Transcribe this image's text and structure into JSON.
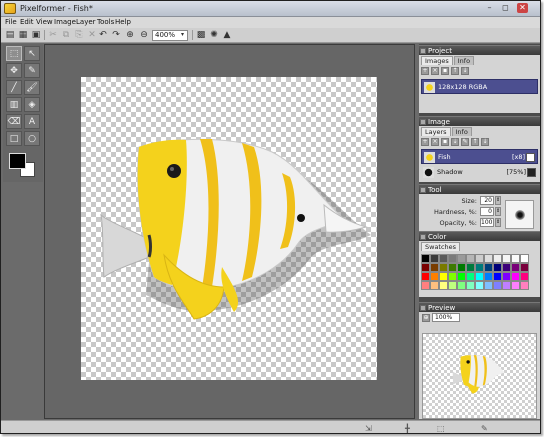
{
  "window": {
    "title": "Pixelformer - Fish*",
    "minimize": "–",
    "restore": "◻",
    "close": "✕"
  },
  "menu": [
    "File",
    "Edit",
    "View",
    "Image",
    "Layer",
    "Tools",
    "Help"
  ],
  "toolbar": {
    "zoom": "400%",
    "zoom_dropdown": "▾"
  },
  "panels": {
    "project": {
      "title": "Project",
      "tabs": [
        "Images",
        "Info"
      ],
      "items": [
        {
          "label": "128x128 RGBA"
        }
      ]
    },
    "image": {
      "title": "Image",
      "tabs": [
        "Layers",
        "Info"
      ],
      "layers": [
        {
          "name": "Fish",
          "tag": "[x8]"
        },
        {
          "name": "Shadow",
          "tag": "[75%]"
        }
      ]
    },
    "tool": {
      "title": "Tool",
      "fields": [
        {
          "label": "Size:",
          "value": "20"
        },
        {
          "label": "Hardness, %:",
          "value": "0"
        },
        {
          "label": "Opacity, %:",
          "value": "100"
        }
      ]
    },
    "color": {
      "title": "Color",
      "tabs": [
        "Swatches"
      ],
      "swatches": [
        "#000000",
        "#3a3a3a",
        "#5a5a5a",
        "#7a7a7a",
        "#9a9a9a",
        "#b5b5b5",
        "#cccccc",
        "#dddddd",
        "#eeeeee",
        "#f4f4f4",
        "#fafafa",
        "#ffffff",
        "#7a0000",
        "#7a3d00",
        "#7a7a00",
        "#3d7a00",
        "#007a00",
        "#007a3d",
        "#007a7a",
        "#003d7a",
        "#00007a",
        "#3d007a",
        "#7a007a",
        "#7a003d",
        "#ff0000",
        "#ff7f00",
        "#ffff00",
        "#7fff00",
        "#00ff00",
        "#00ff7f",
        "#00ffff",
        "#007fff",
        "#0000ff",
        "#7f00ff",
        "#ff00ff",
        "#ff007f",
        "#ff7f7f",
        "#ffbf7f",
        "#ffff7f",
        "#bfff7f",
        "#7fff7f",
        "#7fffbf",
        "#7fffff",
        "#7fbfff",
        "#7f7fff",
        "#bf7fff",
        "#ff7fff",
        "#ff7fbf"
      ]
    },
    "preview": {
      "title": "Preview",
      "zoom": "100%"
    }
  }
}
